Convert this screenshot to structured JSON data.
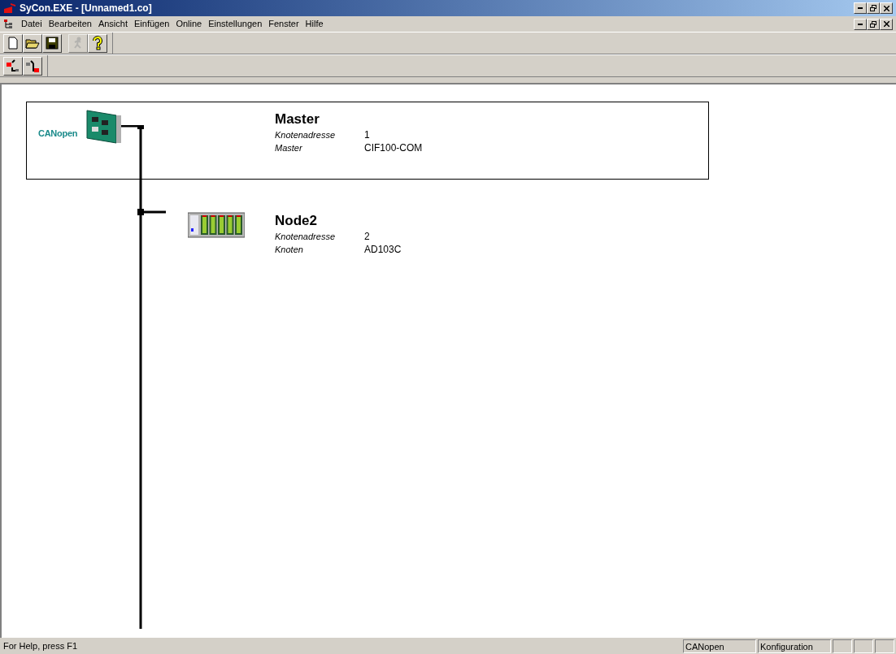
{
  "window": {
    "title": "SyCon.EXE - [Unnamed1.co]"
  },
  "menu": [
    "Datei",
    "Bearbeiten",
    "Ansicht",
    "Einfügen",
    "Online",
    "Einstellungen",
    "Fenster",
    "Hilfe"
  ],
  "toolbar1": [
    {
      "kind": "new",
      "disabled": false
    },
    {
      "kind": "open",
      "disabled": false
    },
    {
      "kind": "save",
      "disabled": false
    },
    {
      "kind": "run",
      "disabled": true
    },
    {
      "kind": "help",
      "disabled": false
    }
  ],
  "toolbar2": [
    {
      "kind": "insert-master"
    },
    {
      "kind": "insert-node"
    }
  ],
  "nodes": [
    {
      "kind": "master",
      "logo": "CANopen",
      "name": "Master",
      "fields": [
        {
          "label": "Knotenadresse",
          "value": "1"
        },
        {
          "label": "Master",
          "value": "CIF100-COM"
        }
      ],
      "selected": true
    },
    {
      "kind": "node",
      "name": "Node2",
      "fields": [
        {
          "label": "Knotenadresse",
          "value": "2"
        },
        {
          "label": "Knoten",
          "value": "AD103C"
        }
      ],
      "selected": false
    }
  ],
  "status_bar": {
    "help": "For Help, press F1",
    "panes": [
      "CANopen",
      "Konfiguration"
    ]
  }
}
